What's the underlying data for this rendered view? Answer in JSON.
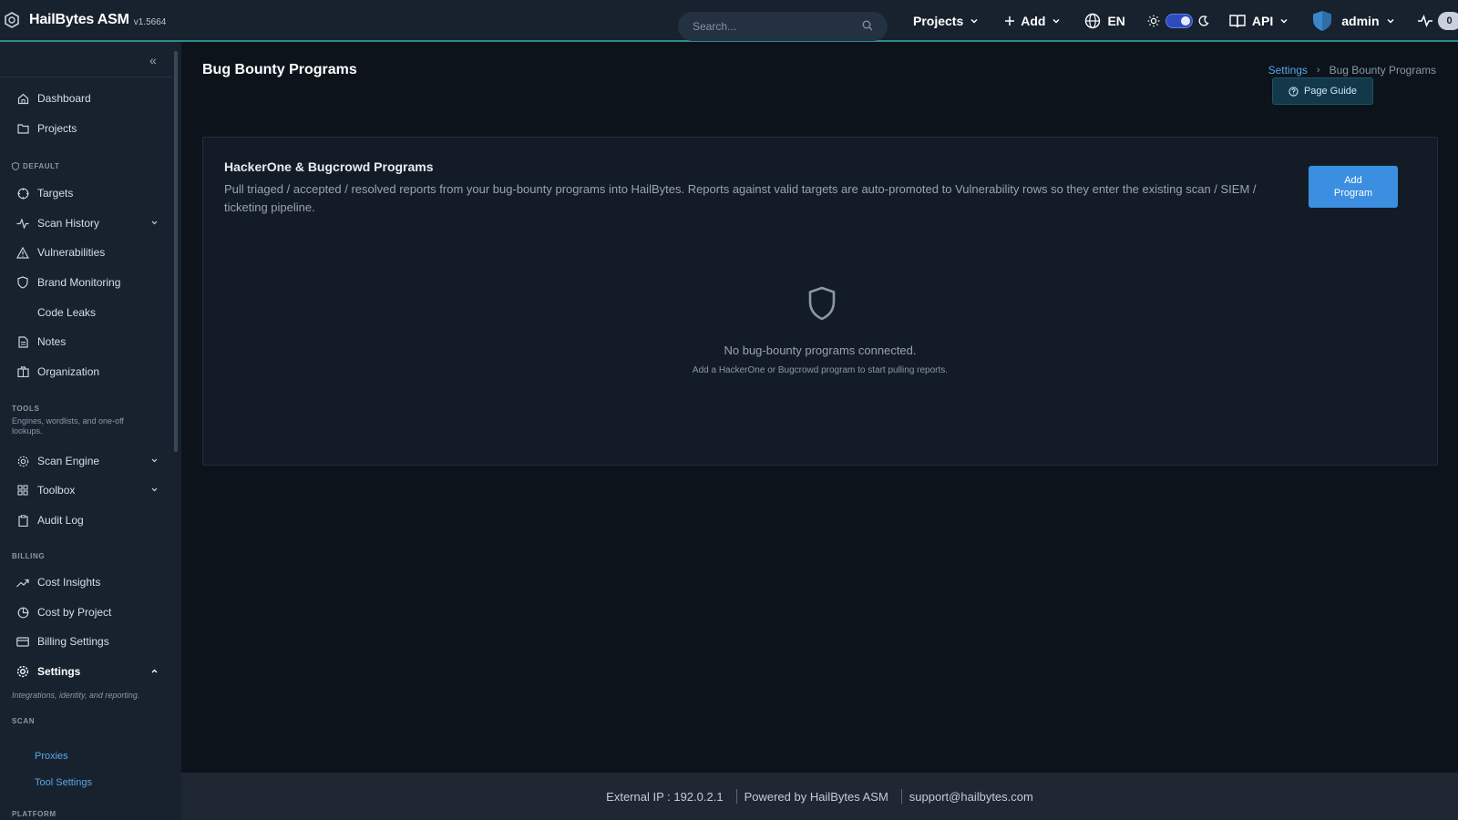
{
  "app": {
    "name": "HailBytes ASM",
    "version": "v1.5664"
  },
  "topbar": {
    "search_placeholder": "Search...",
    "projects_label": "Projects",
    "add_label": "Add",
    "language": "EN",
    "api_label": "API",
    "user": "admin",
    "activity_count": "0"
  },
  "sidebar": {
    "items": {
      "dashboard": "Dashboard",
      "projects": "Projects",
      "targets": "Targets",
      "scan_history": "Scan History",
      "vulnerabilities": "Vulnerabilities",
      "brand_monitoring": "Brand Monitoring",
      "code_leaks": "Code Leaks",
      "notes": "Notes",
      "organization": "Organization",
      "scan_engine": "Scan Engine",
      "toolbox": "Toolbox",
      "audit_log": "Audit Log",
      "cost_insights": "Cost Insights",
      "cost_by_project": "Cost by Project",
      "billing_settings": "Billing Settings",
      "settings": "Settings"
    },
    "sections": {
      "default": "DEFAULT",
      "tools": "TOOLS",
      "tools_desc": "Engines, wordlists, and one-off lookups.",
      "billing": "BILLING",
      "settings_desc": "Integrations, identity, and reporting.",
      "scan": "SCAN",
      "platform": "PLATFORM"
    },
    "sub_items": {
      "proxies": "Proxies",
      "tool_settings": "Tool Settings"
    }
  },
  "page": {
    "title": "Bug Bounty Programs",
    "breadcrumb_parent": "Settings",
    "breadcrumb_current": "Bug Bounty Programs",
    "guide_button": "Page Guide"
  },
  "card": {
    "title": "HackerOne & Bugcrowd Programs",
    "description": "Pull triaged / accepted / resolved reports from your bug-bounty programs into HailBytes. Reports against valid targets are auto-promoted to Vulnerability rows so they enter the existing scan / SIEM / ticketing pipeline.",
    "add_button": "Add Program",
    "empty_title": "No bug-bounty programs connected.",
    "empty_subtitle": "Add a HackerOne or Bugcrowd program to start pulling reports."
  },
  "footer": {
    "external_ip": "External IP : 192.0.2.1",
    "powered_by": "Powered by HailBytes ASM",
    "support": "support@hailbytes.com"
  }
}
